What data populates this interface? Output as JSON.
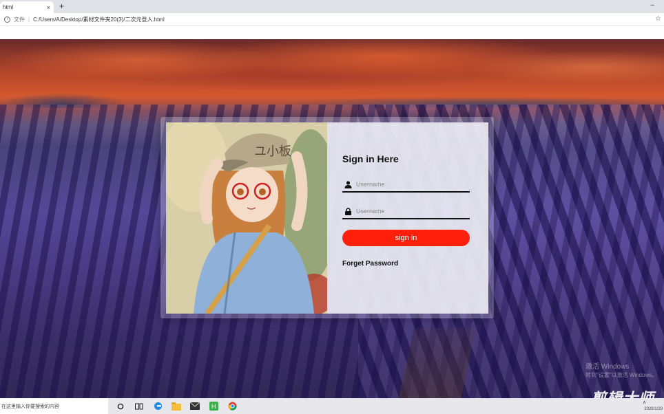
{
  "browser": {
    "tab_title": "html",
    "close_glyph": "×",
    "new_tab_glyph": "+",
    "minimize_glyph": "–",
    "not_secure_label": "文件",
    "address_separator": "|",
    "url": "C:/Users/A/Desktop/素材文件夹20(3)/二次元登入.html",
    "star_glyph": "☆"
  },
  "form": {
    "title": "Sign in Here",
    "username_placeholder": "Username",
    "password_placeholder": "Username",
    "signin_label": "sign in",
    "forget_label": "Forget Password",
    "accent_color": "#ff1f0a"
  },
  "watermark": {
    "activate_line1": "激活 Windows",
    "activate_line2": "转到\"设置\"以激活 Windows。",
    "editor_logo": "剪辑大师"
  },
  "taskbar": {
    "search_placeholder": "在这里输入你要搜索的内容",
    "icons": [
      "cortana-icon",
      "task-view-icon",
      "edge-icon",
      "explorer-icon",
      "mail-icon",
      "hbuilder-icon",
      "chrome-icon"
    ],
    "date": "2020/1/29"
  }
}
